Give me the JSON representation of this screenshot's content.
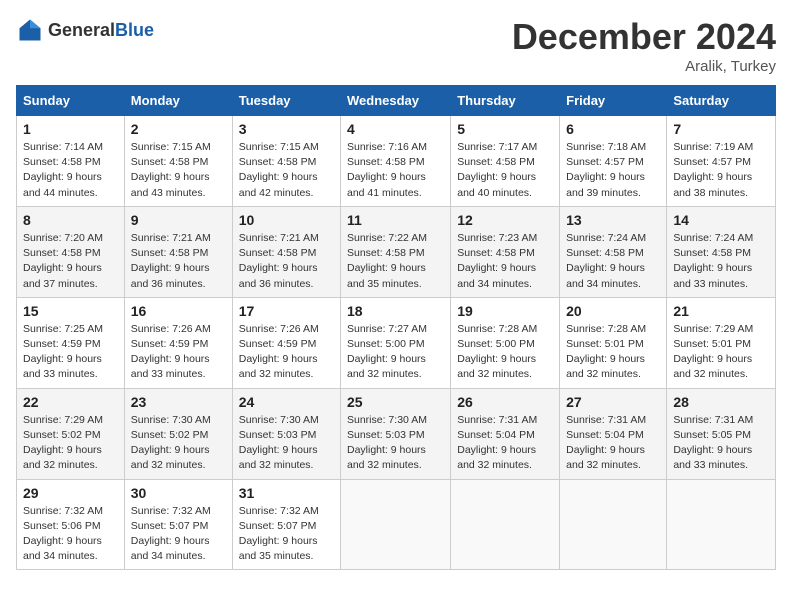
{
  "logo": {
    "text_general": "General",
    "text_blue": "Blue"
  },
  "title": "December 2024",
  "location": "Aralik, Turkey",
  "days_of_week": [
    "Sunday",
    "Monday",
    "Tuesday",
    "Wednesday",
    "Thursday",
    "Friday",
    "Saturday"
  ],
  "weeks": [
    [
      {
        "day": "1",
        "sunrise": "7:14 AM",
        "sunset": "4:58 PM",
        "daylight": "9 hours and 44 minutes."
      },
      {
        "day": "2",
        "sunrise": "7:15 AM",
        "sunset": "4:58 PM",
        "daylight": "9 hours and 43 minutes."
      },
      {
        "day": "3",
        "sunrise": "7:15 AM",
        "sunset": "4:58 PM",
        "daylight": "9 hours and 42 minutes."
      },
      {
        "day": "4",
        "sunrise": "7:16 AM",
        "sunset": "4:58 PM",
        "daylight": "9 hours and 41 minutes."
      },
      {
        "day": "5",
        "sunrise": "7:17 AM",
        "sunset": "4:58 PM",
        "daylight": "9 hours and 40 minutes."
      },
      {
        "day": "6",
        "sunrise": "7:18 AM",
        "sunset": "4:57 PM",
        "daylight": "9 hours and 39 minutes."
      },
      {
        "day": "7",
        "sunrise": "7:19 AM",
        "sunset": "4:57 PM",
        "daylight": "9 hours and 38 minutes."
      }
    ],
    [
      {
        "day": "8",
        "sunrise": "7:20 AM",
        "sunset": "4:58 PM",
        "daylight": "9 hours and 37 minutes."
      },
      {
        "day": "9",
        "sunrise": "7:21 AM",
        "sunset": "4:58 PM",
        "daylight": "9 hours and 36 minutes."
      },
      {
        "day": "10",
        "sunrise": "7:21 AM",
        "sunset": "4:58 PM",
        "daylight": "9 hours and 36 minutes."
      },
      {
        "day": "11",
        "sunrise": "7:22 AM",
        "sunset": "4:58 PM",
        "daylight": "9 hours and 35 minutes."
      },
      {
        "day": "12",
        "sunrise": "7:23 AM",
        "sunset": "4:58 PM",
        "daylight": "9 hours and 34 minutes."
      },
      {
        "day": "13",
        "sunrise": "7:24 AM",
        "sunset": "4:58 PM",
        "daylight": "9 hours and 34 minutes."
      },
      {
        "day": "14",
        "sunrise": "7:24 AM",
        "sunset": "4:58 PM",
        "daylight": "9 hours and 33 minutes."
      }
    ],
    [
      {
        "day": "15",
        "sunrise": "7:25 AM",
        "sunset": "4:59 PM",
        "daylight": "9 hours and 33 minutes."
      },
      {
        "day": "16",
        "sunrise": "7:26 AM",
        "sunset": "4:59 PM",
        "daylight": "9 hours and 33 minutes."
      },
      {
        "day": "17",
        "sunrise": "7:26 AM",
        "sunset": "4:59 PM",
        "daylight": "9 hours and 32 minutes."
      },
      {
        "day": "18",
        "sunrise": "7:27 AM",
        "sunset": "5:00 PM",
        "daylight": "9 hours and 32 minutes."
      },
      {
        "day": "19",
        "sunrise": "7:28 AM",
        "sunset": "5:00 PM",
        "daylight": "9 hours and 32 minutes."
      },
      {
        "day": "20",
        "sunrise": "7:28 AM",
        "sunset": "5:01 PM",
        "daylight": "9 hours and 32 minutes."
      },
      {
        "day": "21",
        "sunrise": "7:29 AM",
        "sunset": "5:01 PM",
        "daylight": "9 hours and 32 minutes."
      }
    ],
    [
      {
        "day": "22",
        "sunrise": "7:29 AM",
        "sunset": "5:02 PM",
        "daylight": "9 hours and 32 minutes."
      },
      {
        "day": "23",
        "sunrise": "7:30 AM",
        "sunset": "5:02 PM",
        "daylight": "9 hours and 32 minutes."
      },
      {
        "day": "24",
        "sunrise": "7:30 AM",
        "sunset": "5:03 PM",
        "daylight": "9 hours and 32 minutes."
      },
      {
        "day": "25",
        "sunrise": "7:30 AM",
        "sunset": "5:03 PM",
        "daylight": "9 hours and 32 minutes."
      },
      {
        "day": "26",
        "sunrise": "7:31 AM",
        "sunset": "5:04 PM",
        "daylight": "9 hours and 32 minutes."
      },
      {
        "day": "27",
        "sunrise": "7:31 AM",
        "sunset": "5:04 PM",
        "daylight": "9 hours and 32 minutes."
      },
      {
        "day": "28",
        "sunrise": "7:31 AM",
        "sunset": "5:05 PM",
        "daylight": "9 hours and 33 minutes."
      }
    ],
    [
      {
        "day": "29",
        "sunrise": "7:32 AM",
        "sunset": "5:06 PM",
        "daylight": "9 hours and 34 minutes."
      },
      {
        "day": "30",
        "sunrise": "7:32 AM",
        "sunset": "5:07 PM",
        "daylight": "9 hours and 34 minutes."
      },
      {
        "day": "31",
        "sunrise": "7:32 AM",
        "sunset": "5:07 PM",
        "daylight": "9 hours and 35 minutes."
      },
      null,
      null,
      null,
      null
    ]
  ]
}
